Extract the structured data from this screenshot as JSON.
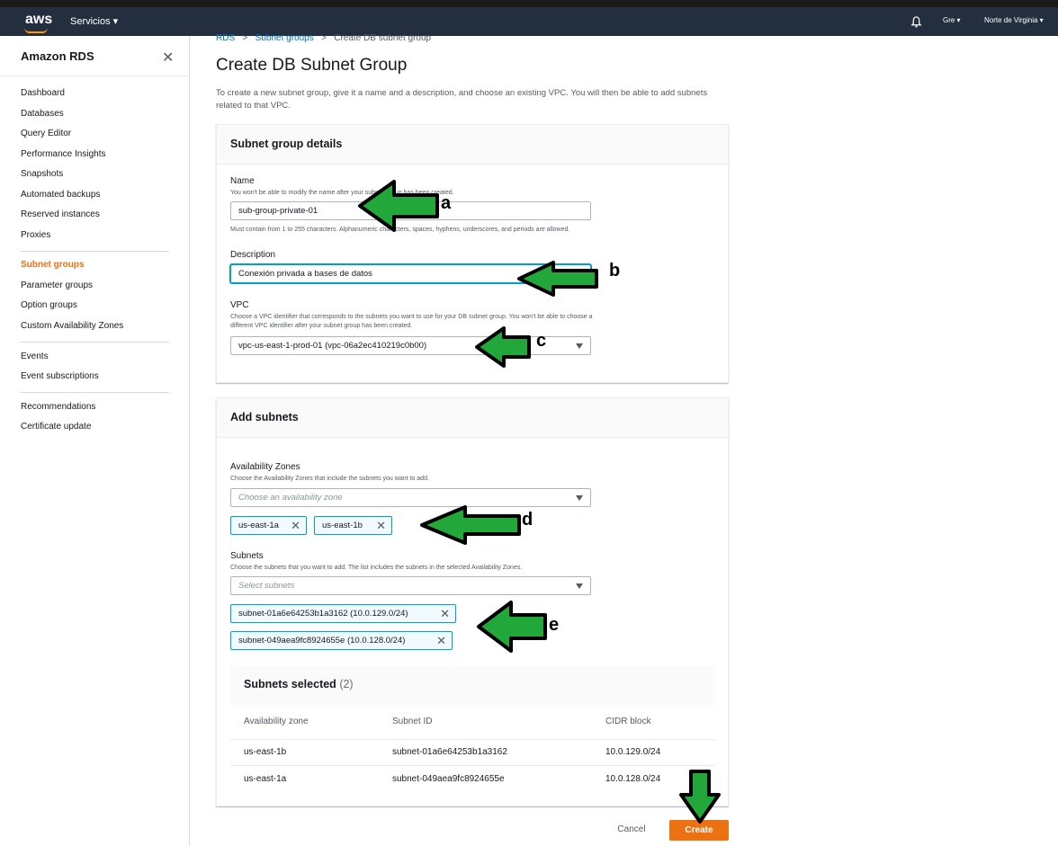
{
  "topbar": {
    "logo": "aws",
    "services": "Servicios ▾",
    "user": "Gre ▾",
    "region": "Norte de Virginia ▾"
  },
  "sidebar": {
    "title": "Amazon RDS",
    "items": [
      {
        "label": "Dashboard"
      },
      {
        "label": "Databases"
      },
      {
        "label": "Query Editor"
      },
      {
        "label": "Performance Insights"
      },
      {
        "label": "Snapshots"
      },
      {
        "label": "Automated backups"
      },
      {
        "label": "Reserved instances"
      },
      {
        "label": "Proxies"
      },
      {
        "label": "Subnet groups"
      },
      {
        "label": "Parameter groups"
      },
      {
        "label": "Option groups"
      },
      {
        "label": "Custom Availability Zones"
      },
      {
        "label": "Events"
      },
      {
        "label": "Event subscriptions"
      },
      {
        "label": "Recommendations"
      },
      {
        "label": "Certificate update"
      }
    ]
  },
  "breadcrumb": {
    "rds": "RDS",
    "subnet_groups": "Subnet groups",
    "current": "Create DB subnet group",
    "sep": ">"
  },
  "page": {
    "title": "Create DB Subnet Group",
    "intro": "To create a new subnet group, give it a name and a description, and choose an existing VPC. You will then be able to add subnets related to that VPC."
  },
  "details": {
    "header": "Subnet group details",
    "name_label": "Name",
    "name_hint": "You won't be able to modify the name after your subnet group has been created.",
    "name_value": "sub-group-private-01",
    "name_constraint": "Must contain from 1 to 255 characters. Alphanumeric characters, spaces, hyphens, underscores, and periods are allowed.",
    "desc_label": "Description",
    "desc_value": "Conexión privada a bases de datos",
    "vpc_label": "VPC",
    "vpc_hint_1": "Choose a VPC identifier that corresponds to the subnets you want to use for your DB subnet group. You won't be able to choose a",
    "vpc_hint_2": "different VPC identifier after your subnet group has been created.",
    "vpc_value": "vpc-us-east-1-prod-01 (vpc-06a2ec410219c0b00)"
  },
  "subnets": {
    "header": "Add subnets",
    "az_label": "Availability Zones",
    "az_hint": "Choose the Availability Zones that include the subnets you want to add.",
    "az_placeholder": "Choose an availability zone",
    "az_tokens": [
      "us-east-1a",
      "us-east-1b"
    ],
    "subnets_label": "Subnets",
    "subnets_hint": "Choose the subnets that you want to add. The list includes the subnets in the selected Availability Zones.",
    "subnets_placeholder": "Select subnets",
    "subnet_tokens": [
      "subnet-01a6e64253b1a3162 (10.0.129.0/24)",
      "subnet-049aea9fc8924655e (10.0.128.0/24)"
    ]
  },
  "selected": {
    "title": "Subnets selected",
    "count": "(2)",
    "columns": [
      "Availability zone",
      "Subnet ID",
      "CIDR block"
    ],
    "rows": [
      [
        "us-east-1b",
        "subnet-01a6e64253b1a3162",
        "10.0.129.0/24"
      ],
      [
        "us-east-1a",
        "subnet-049aea9fc8924655e",
        "10.0.128.0/24"
      ]
    ]
  },
  "actions": {
    "cancel": "Cancel",
    "create": "Create"
  },
  "annotations": {
    "a": "a",
    "b": "b",
    "c": "c",
    "d": "d",
    "e": "e"
  },
  "colors": {
    "arrow_fill": "#22a83a",
    "accent": "#ec7211",
    "link": "#0073bb",
    "topbar": "#232f3e"
  }
}
